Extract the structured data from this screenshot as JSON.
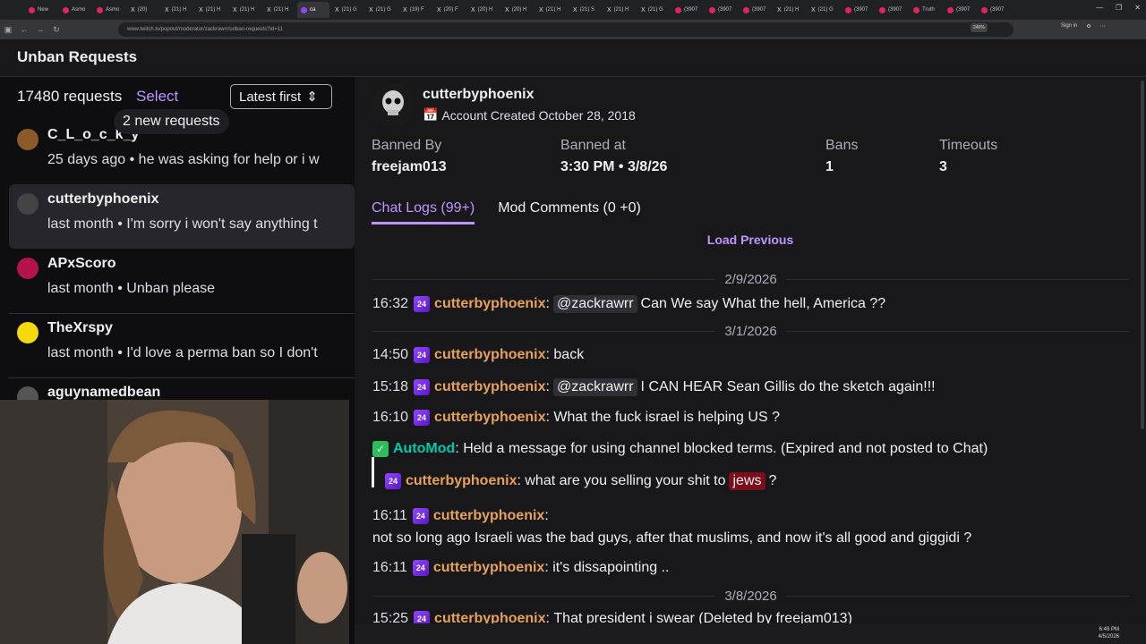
{
  "browser": {
    "tabs": [
      {
        "label": "New",
        "icon": "red"
      },
      {
        "label": "Asmo",
        "icon": "red"
      },
      {
        "label": "Asmo",
        "icon": "red"
      },
      {
        "label": "(20)",
        "icon": "x"
      },
      {
        "label": "(21) H",
        "icon": "x"
      },
      {
        "label": "(21) H",
        "icon": "x"
      },
      {
        "label": "(21) H",
        "icon": "x"
      },
      {
        "label": "(21) H",
        "icon": "x"
      },
      {
        "label": "ca",
        "icon": "tw",
        "active": true
      },
      {
        "label": "(21) G",
        "icon": "x"
      },
      {
        "label": "(21) G",
        "icon": "x"
      },
      {
        "label": "(19) F",
        "icon": "x"
      },
      {
        "label": "(20) F",
        "icon": "x"
      },
      {
        "label": "(20) H",
        "icon": "x"
      },
      {
        "label": "(20) H",
        "icon": "x"
      },
      {
        "label": "(21) H",
        "icon": "x"
      },
      {
        "label": "(21) S",
        "icon": "x"
      },
      {
        "label": "(21) H",
        "icon": "x"
      },
      {
        "label": "(21) G",
        "icon": "x"
      },
      {
        "label": "(3907",
        "icon": "red"
      },
      {
        "label": "(3907",
        "icon": "red"
      },
      {
        "label": "(3907",
        "icon": "red"
      },
      {
        "label": "(21) H",
        "icon": "x"
      },
      {
        "label": "(21) G",
        "icon": "x"
      },
      {
        "label": "(3907",
        "icon": "red"
      },
      {
        "label": "(3907",
        "icon": "red"
      },
      {
        "label": "Truth",
        "icon": "red"
      },
      {
        "label": "(3907",
        "icon": "red"
      },
      {
        "label": "(3907",
        "icon": "red"
      }
    ],
    "url": "www.twitch.tv/popout/moderator/zackrawrr/unban-requests?id=11",
    "zoom": "240%",
    "signin": "Sign in"
  },
  "header": {
    "title": "Unban Requests"
  },
  "list": {
    "count": "17480 requests",
    "select": "Select",
    "sort": "Latest first",
    "new_requests": "2 new requests",
    "items": [
      {
        "name": "C_L_o_c_k_y",
        "msg": "25 days ago • he was asking for help or i w",
        "avatar": "#8a5a2a"
      },
      {
        "name": "cutterbyphoenix",
        "msg": "last month • I'm sorry i won't say anything t",
        "avatar": "#444444"
      },
      {
        "name": "APxScoro",
        "msg": "last month • Unban please",
        "avatar": "#b3124a"
      },
      {
        "name": "TheXrspy",
        "msg": "last month • I'd love a perma ban so I don't",
        "avatar": "#f5d90a"
      },
      {
        "name": "aguynamedbean",
        "msg": "",
        "avatar": "#555555"
      }
    ]
  },
  "detail": {
    "username": "cutterbyphoenix",
    "created": "Account Created October 28, 2018",
    "banned_by_label": "Banned By",
    "banned_by": "freejam013",
    "banned_at_label": "Banned at",
    "banned_at": "3:30 PM • 3/8/26",
    "bans_label": "Bans",
    "bans": "1",
    "timeouts_label": "Timeouts",
    "timeouts": "3",
    "tab_chat": "Chat Logs (99+)",
    "tab_mod": "Mod Comments (0 +0)",
    "load_previous": "Load Previous",
    "date1": "2/9/2026",
    "date2": "3/1/2026",
    "date3": "3/8/2026",
    "logs": [
      {
        "time": "16:32",
        "name": "cutterbyphoenix",
        "mention": "@zackrawrr",
        "text": "Can We say What the hell, America ??"
      },
      {
        "time": "14:50",
        "name": "cutterbyphoenix",
        "text": "back"
      },
      {
        "time": "15:18",
        "name": "cutterbyphoenix",
        "mention": "@zackrawrr",
        "text": "I CAN HEAR Sean Gillis do the sketch again!!!"
      },
      {
        "time": "16:10",
        "name": "cutterbyphoenix",
        "text": "What the fuck israel is helping US ?"
      },
      {
        "automod": "AutoMod",
        "text": "Held a message for using channel blocked terms. (Expired and not posted to Chat)"
      },
      {
        "name": "cutterbyphoenix",
        "text": "what are you selling your shit to",
        "flag": "jews",
        "after": "?"
      },
      {
        "time": "16:11",
        "name": "cutterbyphoenix",
        "text": ""
      },
      {
        "text": "not so long ago Israeli was the bad guys, after that muslims, and now it's all good and giggidi ?"
      },
      {
        "time": "16:11",
        "name": "cutterbyphoenix",
        "text": "it's dissapointing .."
      },
      {
        "time": "15:25",
        "name": "cutterbyphoenix",
        "text": "That president i swear (Deleted by freejam013)"
      }
    ]
  },
  "taskbar": {
    "clock_time": "6:49 PM",
    "clock_date": "4/5/2026"
  }
}
